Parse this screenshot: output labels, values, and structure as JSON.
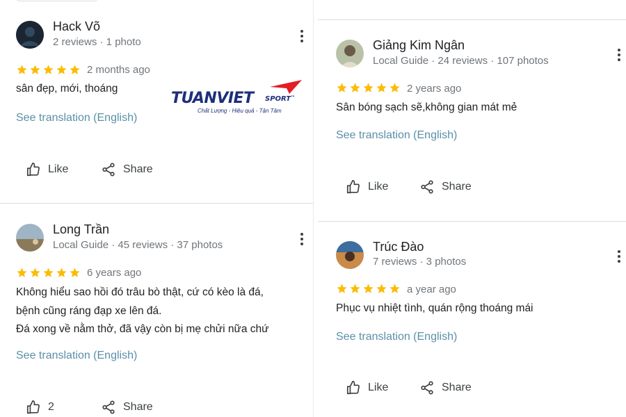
{
  "colors": {
    "star": "#fbbc04",
    "link": "#5a8fa8",
    "meta": "#70757a",
    "text": "#202124"
  },
  "reviews": [
    {
      "author": "Hack Võ",
      "meta": "2 reviews · 1 photo",
      "rating": 5,
      "time": "2 months ago",
      "text": [
        "sân đẹp, mới, thoáng"
      ],
      "translate": "See translation (English)",
      "like": "Like",
      "share": "Share"
    },
    {
      "author": "Long Trần",
      "meta": "Local Guide · 45 reviews · 37 photos",
      "rating": 5,
      "time": "6 years ago",
      "text": [
        "Không hiểu sao hồi đó trâu bò thật, cứ có kèo là đá,",
        "bệnh cũng ráng đạp xe lên đá.",
        "Đá xong về nằm thở, đã vậy còn bị mẹ chửi nữa chứ"
      ],
      "translate": "See translation (English)",
      "like": "2",
      "share": "Share"
    },
    {
      "author": "Giảng Kim Ngân",
      "meta": "Local Guide · 24 reviews · 107 photos",
      "rating": 5,
      "time": "2 years ago",
      "text": [
        "Sân bóng sạch sẽ,không gian mát mẻ"
      ],
      "translate": "See translation (English)",
      "like": "Like",
      "share": "Share"
    },
    {
      "author": "Trúc Đào",
      "meta": "7 reviews · 3 photos",
      "rating": 5,
      "time": "a year ago",
      "text": [
        "Phục vụ nhiệt tình, quán rộng thoáng mái"
      ],
      "translate": "See translation (English)",
      "like": "Like",
      "share": "Share"
    }
  ],
  "logo": {
    "main": "TUANVIET",
    "sport": "SPORT",
    "tm": "™",
    "tagline": "Chất Lượng - Hiệu quả - Tận Tâm"
  }
}
